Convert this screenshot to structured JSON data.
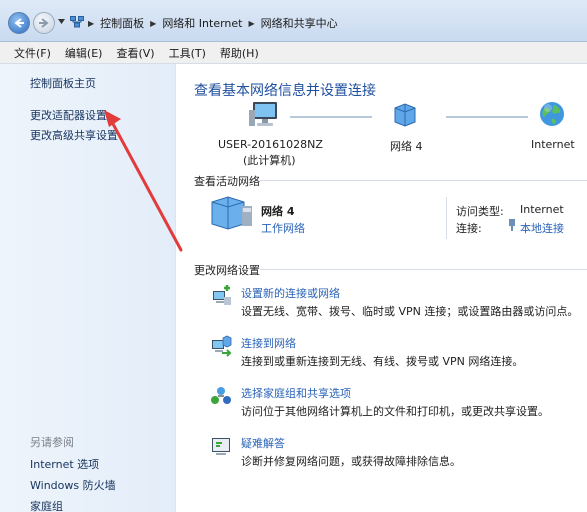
{
  "breadcrumb": [
    "控制面板",
    "网络和 Internet",
    "网络和共享中心"
  ],
  "menu": [
    "文件(F)",
    "编辑(E)",
    "查看(V)",
    "工具(T)",
    "帮助(H)"
  ],
  "sidebar": {
    "links": [
      "控制面板主页",
      "更改适配器设置",
      "更改高级共享设置"
    ],
    "see_also_title": "另请参阅",
    "see_also": [
      "Internet 选项",
      "Windows 防火墙",
      "家庭组"
    ]
  },
  "main": {
    "title": "查看基本网络信息并设置连接",
    "map": {
      "computer_name": "USER-20161028NZ",
      "computer_sub": "(此计算机)",
      "network": "网络  4",
      "internet": "Internet"
    },
    "active_section": "查看活动网络",
    "active_network": {
      "name": "网络  4",
      "type": "工作网络",
      "access_type_label": "访问类型:",
      "access_type_value": "Internet",
      "connection_label": "连接:",
      "connection_value": "本地连接"
    },
    "change_section": "更改网络设置",
    "tasks": [
      {
        "link": "设置新的连接或网络",
        "desc": "设置无线、宽带、拨号、临时或 VPN 连接；或设置路由器或访问点。"
      },
      {
        "link": "连接到网络",
        "desc": "连接到或重新连接到无线、有线、拨号或 VPN 网络连接。"
      },
      {
        "link": "选择家庭组和共享选项",
        "desc": "访问位于其他网络计算机上的文件和打印机，或更改共享设置。"
      },
      {
        "link": "疑难解答",
        "desc": "诊断并修复网络问题，或获得故障排除信息。"
      }
    ]
  },
  "colors": {
    "link": "#2a63b8",
    "title": "#1f4f9f",
    "arrow": "#e23b3b"
  }
}
